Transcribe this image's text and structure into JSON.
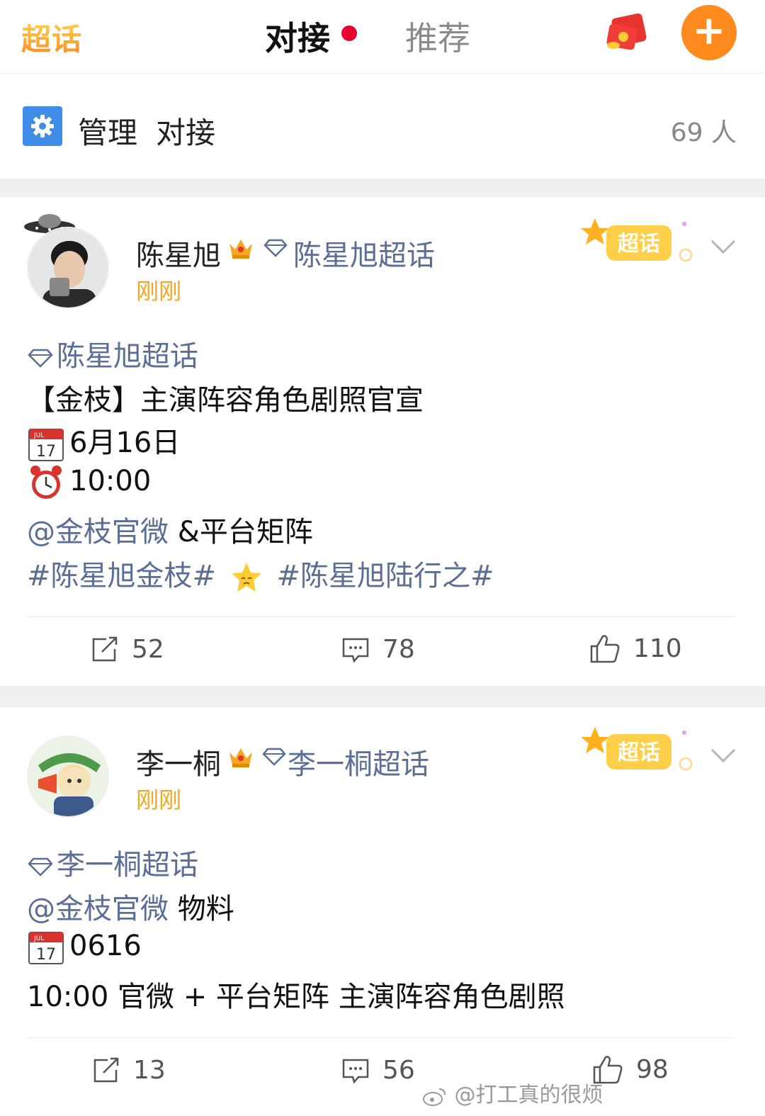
{
  "header": {
    "logo": "超话",
    "tab_active": "对接",
    "tab_recommend": "推荐",
    "plus_label": "+"
  },
  "manage": {
    "label": "管理",
    "name": "对接",
    "count": "69 人"
  },
  "posts": [
    {
      "author": "陈星旭",
      "topic": "陈星旭超话",
      "time": "刚刚",
      "badge": "超话",
      "body_topic": "陈星旭超话",
      "title": "【金枝】主演阵容角色剧照官宣",
      "calendar_month": "JUL",
      "calendar_day": "17",
      "date": "6月16日",
      "clock_time": "10:00",
      "mention": "@金枝官微",
      "mention_suffix": " &平台矩阵",
      "hashtag1": "#陈星旭金枝#",
      "hashtag2": "#陈星旭陆行之#",
      "reposts": "52",
      "comments": "78",
      "likes": "110"
    },
    {
      "author": "李一桐",
      "topic": "李一桐超话",
      "time": "刚刚",
      "badge": "超话",
      "body_topic": "李一桐超话",
      "mention": "@金枝官微",
      "mention_suffix": " 物料",
      "calendar_month": "JUL",
      "calendar_day": "17",
      "date": "0616",
      "detail": "10:00 官微 + 平台矩阵 主演阵容角色剧照",
      "reposts": "13",
      "comments": "56",
      "likes": "98"
    }
  ],
  "watermark": "@打工真的很烦"
}
